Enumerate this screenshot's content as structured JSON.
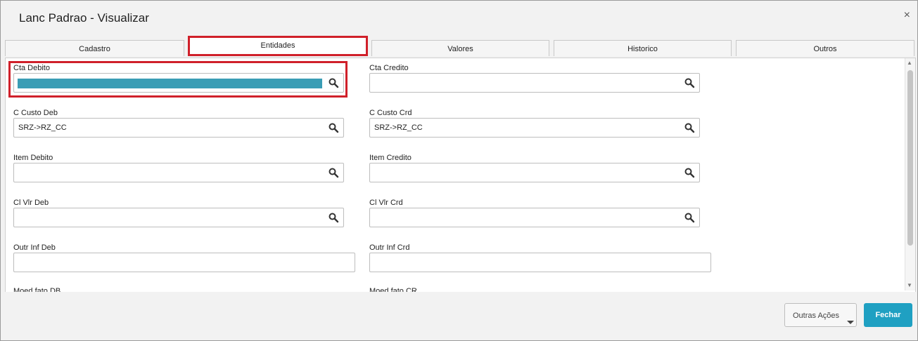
{
  "window": {
    "title": "Lanc Padrao - Visualizar",
    "close_symbol": "×"
  },
  "tabs": [
    {
      "label": "Cadastro",
      "active": false
    },
    {
      "label": "Entidades",
      "active": true
    },
    {
      "label": "Valores",
      "active": false
    },
    {
      "label": "Historico",
      "active": false
    },
    {
      "label": "Outros",
      "active": false
    }
  ],
  "fields": {
    "cta_debito": {
      "label": "Cta Debito",
      "value": ""
    },
    "cta_credito": {
      "label": "Cta Credito",
      "value": ""
    },
    "c_custo_deb": {
      "label": "C Custo Deb",
      "value": "SRZ->RZ_CC"
    },
    "c_custo_crd": {
      "label": "C Custo Crd",
      "value": "SRZ->RZ_CC"
    },
    "item_debito": {
      "label": "Item Debito",
      "value": ""
    },
    "item_credito": {
      "label": "Item Credito",
      "value": ""
    },
    "cl_vlr_deb": {
      "label": "Cl Vlr Deb",
      "value": ""
    },
    "cl_vlr_crd": {
      "label": "Cl Vlr Crd",
      "value": ""
    },
    "outr_inf_deb": {
      "label": "Outr Inf Deb",
      "value": ""
    },
    "outr_inf_crd": {
      "label": "Outr Inf Crd",
      "value": ""
    },
    "moed_fato_db": {
      "label": "Moed fato DB"
    },
    "moed_fato_cr": {
      "label": "Moed fato CR"
    }
  },
  "footer": {
    "outras_acoes": "Outras Ações",
    "fechar": "Fechar"
  },
  "colors": {
    "accent": "#1fa0c2",
    "highlight_border": "#d0202a",
    "selection_fill": "#3a9db5"
  },
  "icons": {
    "lookup": "search-icon",
    "close": "close-icon",
    "dropdown": "caret-down-icon"
  }
}
